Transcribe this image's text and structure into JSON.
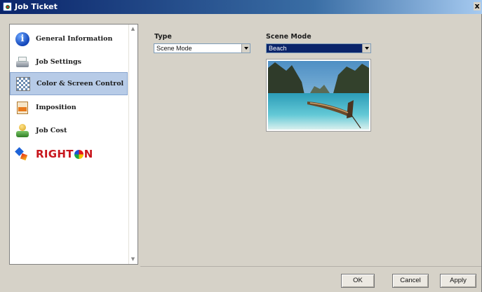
{
  "window": {
    "title": "Job Ticket",
    "close_glyph": "x"
  },
  "sidebar": {
    "items": [
      {
        "label": "General Information",
        "icon": "info-icon"
      },
      {
        "label": "Job Settings",
        "icon": "printer-icon"
      },
      {
        "label": "Color & Screen Control",
        "icon": "color-screen-icon",
        "selected": true
      },
      {
        "label": "Imposition",
        "icon": "imposition-icon"
      },
      {
        "label": "Job Cost",
        "icon": "job-cost-icon"
      }
    ],
    "brand": {
      "text_left": "RIGHT",
      "text_right": "N"
    }
  },
  "main": {
    "type_label": "Type",
    "type_value": "Scene Mode",
    "scene_mode_label": "Scene Mode",
    "scene_mode_value": "Beach"
  },
  "buttons": {
    "ok": "OK",
    "cancel": "Cancel",
    "apply": "Apply"
  },
  "colors": {
    "title_bar": "#0a246a",
    "selection": "#b7cbe7",
    "window_bg": "#d6d2c8"
  }
}
